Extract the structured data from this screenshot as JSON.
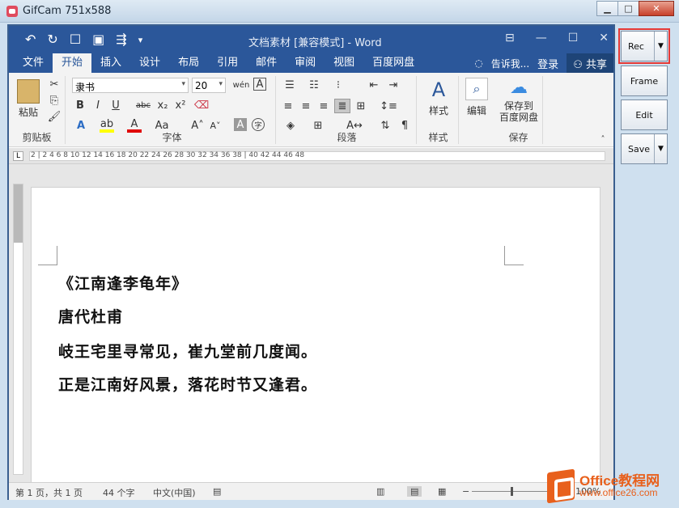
{
  "gifcam": {
    "title": "GifCam 751x588",
    "buttons": {
      "rec": "Rec",
      "frame": "Frame",
      "edit": "Edit",
      "save": "Save"
    }
  },
  "word": {
    "doc_title": "文档素材 [兼容模式] - Word",
    "tabs": [
      "文件",
      "开始",
      "插入",
      "设计",
      "布局",
      "引用",
      "邮件",
      "审阅",
      "视图",
      "百度网盘"
    ],
    "tell_me": "告诉我...",
    "login": "登录",
    "share": "共享",
    "ribbon": {
      "paste": "粘贴",
      "clipboard": "剪贴板",
      "font_name": "隶书",
      "font_size": "20",
      "font_group": "字体",
      "paragraph_group": "段落",
      "styles": "样式",
      "styles_group": "样式",
      "edit": "编辑",
      "save_to": "保存到",
      "baidu": "百度网盘",
      "save_group": "保存"
    },
    "ruler": "2  |  2   4   6   8   10  12  14  16  18  20  22  24  26  28  30  32  34  36  38  |  40  42  44  46  48",
    "doc_lines": [
      "《江南逢李龟年》",
      "唐代杜甫",
      "岐王宅里寻常见，崔九堂前几度闻。",
      "正是江南好风景，落花时节又逢君。"
    ],
    "status": {
      "page": "第 1 页，共 1 页",
      "words": "44 个字",
      "lang": "中文(中国)",
      "zoom": "100%"
    }
  },
  "watermark": {
    "brand": "Office教程网",
    "url": "www.office26.com"
  }
}
